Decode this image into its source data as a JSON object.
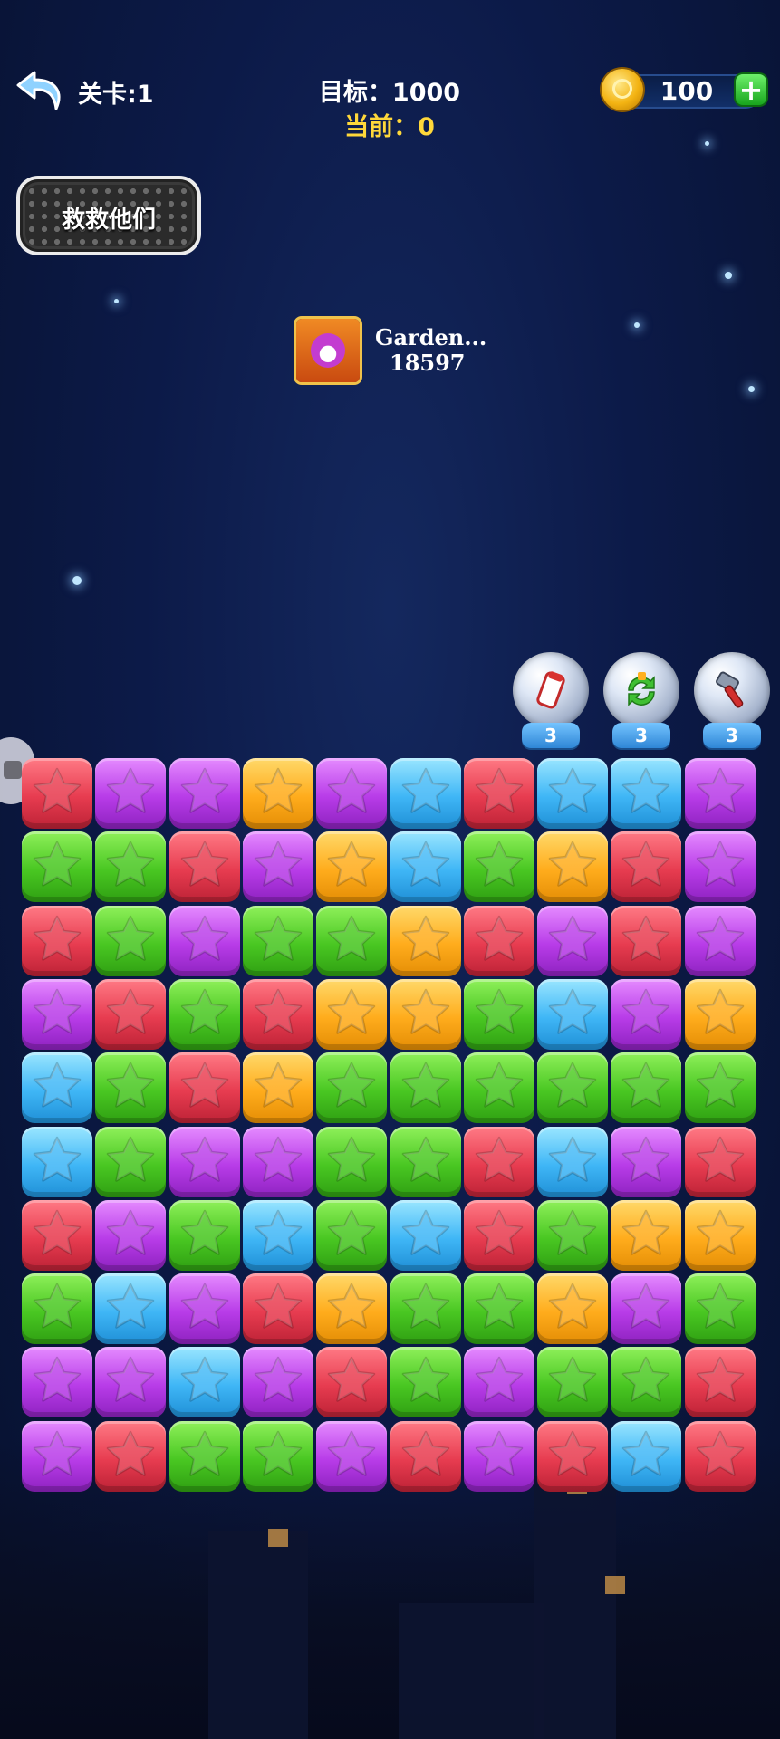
{
  "header": {
    "level_label": "关卡:1",
    "target_label": "目标：1000",
    "current_label": "当前：0",
    "coins": "100",
    "add_symbol": "+"
  },
  "rescue": {
    "label": "救救他们"
  },
  "leaderboard": {
    "name": "Garden...",
    "score": "18597"
  },
  "boosters": [
    {
      "name": "pop-spray-icon",
      "count": "3"
    },
    {
      "name": "shuffle-icon",
      "count": "3"
    },
    {
      "name": "hammer-icon",
      "count": "3"
    }
  ],
  "colors": {
    "red": "#e73c50",
    "purple": "#b83ce8",
    "yellow": "#ffac1c",
    "blue": "#3fb6f6",
    "green": "#49c722",
    "current_score_color": "#ffd83a"
  },
  "board": {
    "rows": [
      [
        "red",
        "purple",
        "purple",
        "yellow",
        "purple",
        "blue",
        "red",
        "blue",
        "blue",
        "purple"
      ],
      [
        "green",
        "green",
        "red",
        "purple",
        "yellow",
        "blue",
        "green",
        "yellow",
        "red",
        "purple"
      ],
      [
        "red",
        "green",
        "purple",
        "green",
        "green",
        "yellow",
        "red",
        "purple",
        "red",
        "purple"
      ],
      [
        "purple",
        "red",
        "green",
        "red",
        "yellow",
        "yellow",
        "green",
        "blue",
        "purple",
        "yellow"
      ],
      [
        "blue",
        "green",
        "red",
        "yellow",
        "green",
        "green",
        "green",
        "green",
        "green",
        "green"
      ],
      [
        "blue",
        "green",
        "purple",
        "purple",
        "green",
        "green",
        "red",
        "blue",
        "purple",
        "red"
      ],
      [
        "red",
        "purple",
        "green",
        "blue",
        "green",
        "blue",
        "red",
        "green",
        "yellow",
        "yellow"
      ],
      [
        "green",
        "blue",
        "purple",
        "red",
        "yellow",
        "green",
        "green",
        "yellow",
        "purple",
        "green"
      ],
      [
        "purple",
        "purple",
        "blue",
        "purple",
        "red",
        "green",
        "purple",
        "green",
        "green",
        "red"
      ],
      [
        "purple",
        "red",
        "green",
        "green",
        "purple",
        "red",
        "purple",
        "red",
        "blue",
        "red"
      ]
    ]
  }
}
